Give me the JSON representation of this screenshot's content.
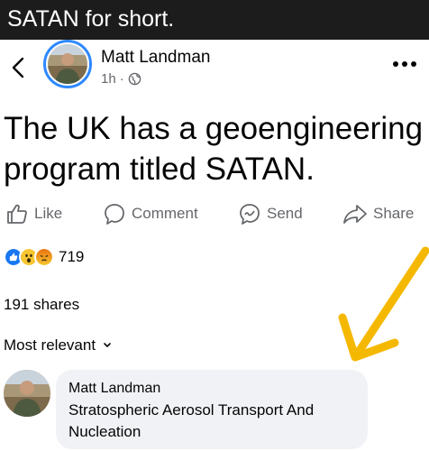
{
  "caption": {
    "text": "SATAN for short."
  },
  "post": {
    "author": "Matt Landman",
    "time": "1h",
    "separator": "·",
    "text": "The UK has a geoengineering program titled SATAN."
  },
  "actions": {
    "like": "Like",
    "comment": "Comment",
    "send": "Send",
    "share": "Share"
  },
  "reactions": {
    "count": "719",
    "types": [
      "like",
      "haha",
      "angry"
    ]
  },
  "shares": "191 shares",
  "comments": {
    "sort_label": "Most relevant",
    "items": [
      {
        "author": "Matt Landman",
        "text": "Stratospheric Aerosol Transport And Nucleation"
      }
    ]
  },
  "colors": {
    "caption_bg": "#1c1c1c",
    "facebook_blue": "#2d88ff",
    "annotation_arrow": "#f5b800",
    "muted_text": "#65676b",
    "bubble_bg": "#f0f2f5"
  },
  "icons": {
    "back": "chevron-left-icon",
    "privacy": "globe-icon",
    "more": "more-dots-icon",
    "like": "thumbs-up-icon",
    "comment": "speech-bubble-icon",
    "send": "messenger-icon",
    "share": "share-arrow-icon",
    "sort": "chevron-down-icon"
  }
}
